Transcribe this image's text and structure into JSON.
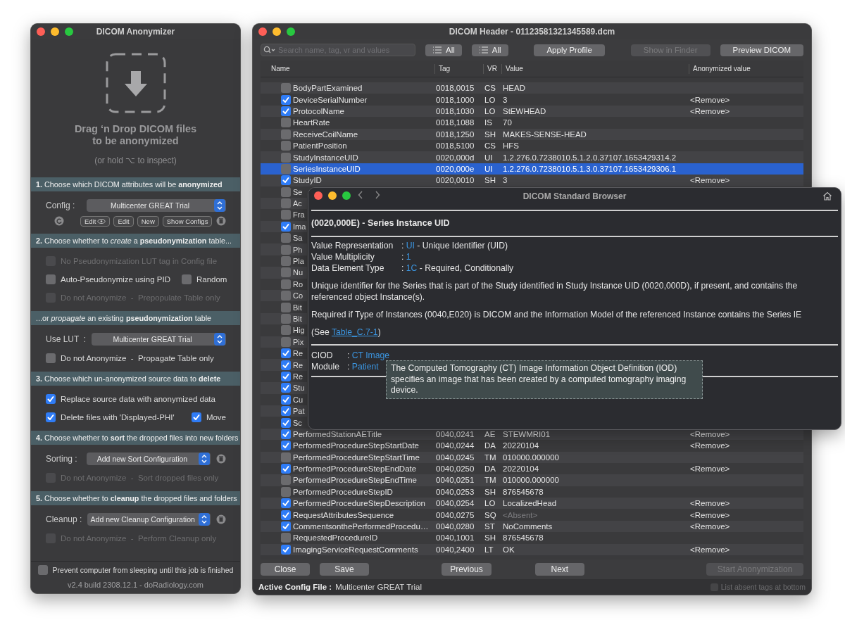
{
  "left_window": {
    "title": "DICOM Anonymizer",
    "drop_text": "Drag ‘n Drop DICOM files\nto be anonymized",
    "drop_hint": "(or hold ⌥ to inspect)",
    "sections": [
      {
        "header": "**1.** Choose which DICOM attributes will be **anonymized**",
        "items": [
          {
            "kind": "select",
            "label": "Config :",
            "value": "Multicenter GREAT Trial",
            "trash": false
          },
          {
            "kind": "buttons",
            "buttons": [
              {
                "label": "Edit",
                "eye": true
              },
              {
                "label": "Edit",
                "eye": false
              },
              {
                "label": "New",
                "eye": false
              },
              {
                "label": "Show Configs",
                "eye": false
              }
            ]
          }
        ]
      },
      {
        "header": "**2.** Choose whether to *create* a **pseudonymization** table...",
        "items": [
          {
            "kind": "checks",
            "checks": [
              {
                "label": "No Pseudonymization LUT tag in Config file",
                "checked": false,
                "disabled": true
              }
            ]
          },
          {
            "kind": "checks",
            "checks": [
              {
                "label": "Auto-Pseudonymize using PID",
                "checked": false,
                "disabled": false
              },
              {
                "label": "Random",
                "checked": false,
                "disabled": false
              }
            ]
          },
          {
            "kind": "checks",
            "checks": [
              {
                "label": "Do not Anonymize  -  Prepopulate Table only",
                "checked": false,
                "disabled": true
              }
            ]
          }
        ]
      },
      {
        "header": "...or *propagate* an existing **pseudonymization** table",
        "items": [
          {
            "kind": "select",
            "label": "Use LUT  :",
            "value": "Multicenter GREAT Trial",
            "trash": false
          },
          {
            "kind": "checks",
            "checks": [
              {
                "label": "Do not Anonymize  -  Propagate Table only",
                "checked": false,
                "disabled": false
              }
            ]
          }
        ]
      },
      {
        "header": "**3.** Choose which un-anonymized source data to **delete**",
        "items": [
          {
            "kind": "checks",
            "checks": [
              {
                "label": "Replace source data with anonymized data",
                "checked": true,
                "disabled": false
              }
            ]
          },
          {
            "kind": "checks",
            "checks": [
              {
                "label": "Delete files with 'Displayed-PHI'",
                "checked": true,
                "disabled": false
              },
              {
                "label": "Move",
                "checked": true,
                "disabled": false
              }
            ]
          }
        ]
      },
      {
        "header": "**4.** Choose whether to **sort** the dropped files into new folders",
        "items": [
          {
            "kind": "select",
            "label": "Sorting :",
            "value": "Add new Sort Configuration",
            "trash": true
          },
          {
            "kind": "checks",
            "checks": [
              {
                "label": "Do not Anonymize  -  Sort dropped files only",
                "checked": false,
                "disabled": true
              }
            ]
          }
        ]
      },
      {
        "header": "**5.** Choose whether to **cleanup** the dropped files and folders",
        "items": [
          {
            "kind": "select",
            "label": "Cleanup :",
            "value": "Add new Cleanup Configuration",
            "trash": true
          },
          {
            "kind": "checks",
            "checks": [
              {
                "label": "Do not Anonymize  -  Perform Cleanup only",
                "checked": false,
                "disabled": true
              }
            ]
          }
        ]
      }
    ],
    "sleep_option": {
      "label": "Prevent computer from sleeping until this job is finished",
      "checked": false
    },
    "version": "v2.4 build 2308.12.1 - doRadiology.com"
  },
  "header_window": {
    "title": "DICOM Header - 01123581321345589.dcm",
    "search": {
      "placeholder": "Search name, tag, vr and values"
    },
    "toolbar": [
      {
        "label": "All",
        "kind": "filter",
        "disabled": false
      },
      {
        "label": "All",
        "kind": "filter",
        "disabled": false
      },
      {
        "label": "Apply Profile",
        "kind": "plain",
        "disabled": false
      },
      {
        "label": "Show in Finder",
        "kind": "plain",
        "disabled": true
      },
      {
        "label": "Preview DICOM",
        "kind": "plain",
        "disabled": false
      }
    ],
    "columns": [
      "Name",
      "Tag",
      "VR",
      "Value",
      "Anonymized value"
    ],
    "rows": [
      {
        "name": "BodyPartExamined",
        "tag": "0018,0015",
        "vr": "CS",
        "value": "HEAD",
        "dimmed": false,
        "checked": false,
        "selected": false
      },
      {
        "name": "DeviceSerialNumber",
        "tag": "0018,1000",
        "vr": "LO",
        "value": "3",
        "dimmed": false,
        "anonymized": "<Remove>",
        "checked": true,
        "selected": false
      },
      {
        "name": "ProtocolName",
        "tag": "0018,1030",
        "vr": "LO",
        "value": "StEWHEAD",
        "dimmed": false,
        "anonymized": "<Remove>",
        "checked": true,
        "selected": false
      },
      {
        "name": "HeartRate",
        "tag": "0018,1088",
        "vr": "IS",
        "value": "70",
        "dimmed": false,
        "checked": false,
        "selected": false
      },
      {
        "name": "ReceiveCoilName",
        "tag": "0018,1250",
        "vr": "SH",
        "value": "MAKES-SENSE-HEAD",
        "dimmed": false,
        "checked": false,
        "selected": false
      },
      {
        "name": "PatientPosition",
        "tag": "0018,5100",
        "vr": "CS",
        "value": "HFS",
        "dimmed": false,
        "checked": false,
        "selected": false
      },
      {
        "name": "StudyInstanceUID",
        "tag": "0020,000d",
        "vr": "UI",
        "value": "1.2.276.0.7238010.5.1.2.0.37107.1653429314.2",
        "dimmed": false,
        "checked": false,
        "selected": false
      },
      {
        "name": "SeriesInstanceUID",
        "tag": "0020,000e",
        "vr": "UI",
        "value": "1.2.276.0.7238010.5.1.3.0.37107.1653429306.1",
        "dimmed": false,
        "checked": false,
        "selected": true
      },
      {
        "name": "StudyID",
        "tag": "0020,0010",
        "vr": "SH",
        "value": "3",
        "dimmed": false,
        "anonymized": "<Remove>",
        "checked": true,
        "selected": false
      },
      {
        "name": "Se",
        "checked": false,
        "selected": false
      },
      {
        "name": "Ac",
        "checked": false,
        "selected": false
      },
      {
        "name": "Fra",
        "checked": false,
        "selected": false
      },
      {
        "name": "Ima",
        "checked": true,
        "selected": false
      },
      {
        "name": "Sa",
        "checked": false,
        "selected": false
      },
      {
        "name": "Ph",
        "checked": false,
        "selected": false
      },
      {
        "name": "Pla",
        "checked": false,
        "selected": false
      },
      {
        "name": "Nu",
        "checked": false,
        "selected": false
      },
      {
        "name": "Ro",
        "checked": false,
        "selected": false
      },
      {
        "name": "Co",
        "checked": false,
        "selected": false
      },
      {
        "name": "Bit",
        "checked": false,
        "selected": false
      },
      {
        "name": "Bit",
        "checked": false,
        "selected": false
      },
      {
        "name": "Hig",
        "checked": false,
        "selected": false
      },
      {
        "name": "Pix",
        "checked": false,
        "selected": false
      },
      {
        "name": "Re",
        "checked": true,
        "selected": false
      },
      {
        "name": "Re",
        "checked": true,
        "selected": false
      },
      {
        "name": "Re",
        "checked": true,
        "selected": false
      },
      {
        "name": "Stu",
        "checked": true,
        "selected": false
      },
      {
        "name": "Cu",
        "checked": true,
        "selected": false
      },
      {
        "name": "Pat",
        "checked": true,
        "selected": false
      },
      {
        "name": "Sc",
        "checked": true,
        "selected": false
      },
      {
        "name": "PerformedStationAETitle",
        "tag": "0040,0241",
        "vr": "AE",
        "value": "STEWMRI01",
        "dimmed": false,
        "anonymized": "<Remove>",
        "checked": true,
        "selected": false
      },
      {
        "name": "PerformedProcedureStepStartDate",
        "tag": "0040,0244",
        "vr": "DA",
        "value": "20220104",
        "dimmed": false,
        "anonymized": "<Remove>",
        "checked": true,
        "selected": false
      },
      {
        "name": "PerformedProcedureStepStartTime",
        "tag": "0040,0245",
        "vr": "TM",
        "value": "010000.000000",
        "dimmed": false,
        "checked": false,
        "selected": false
      },
      {
        "name": "PerformedProcedureStepEndDate",
        "tag": "0040,0250",
        "vr": "DA",
        "value": "20220104",
        "dimmed": false,
        "anonymized": "<Remove>",
        "checked": true,
        "selected": false
      },
      {
        "name": "PerformedProcedureStepEndTime",
        "tag": "0040,0251",
        "vr": "TM",
        "value": "010000.000000",
        "dimmed": false,
        "checked": false,
        "selected": false
      },
      {
        "name": "PerformedProcedureStepID",
        "tag": "0040,0253",
        "vr": "SH",
        "value": "876545678",
        "dimmed": false,
        "checked": false,
        "selected": false
      },
      {
        "name": "PerformedProcedureStepDescription",
        "tag": "0040,0254",
        "vr": "LO",
        "value": "LocalizedHead",
        "dimmed": false,
        "anonymized": "<Remove>",
        "checked": true,
        "selected": false
      },
      {
        "name": "RequestAttributesSequence",
        "tag": "0040,0275",
        "vr": "SQ",
        "value": "<Absent>",
        "dimmed": true,
        "anonymized": "<Remove>",
        "checked": true,
        "selected": false
      },
      {
        "name": "CommentsonthePerformedProcedu…",
        "tag": "0040,0280",
        "vr": "ST",
        "value": "NoComments",
        "dimmed": false,
        "anonymized": "<Remove>",
        "checked": true,
        "selected": false
      },
      {
        "name": "RequestedProcedureID",
        "tag": "0040,1001",
        "vr": "SH",
        "value": "876545678",
        "dimmed": false,
        "checked": false,
        "selected": false
      },
      {
        "name": "ImagingServiceRequestComments",
        "tag": "0040,2400",
        "vr": "LT",
        "value": "OK",
        "dimmed": false,
        "anonymized": "<Remove>",
        "checked": true,
        "selected": false
      }
    ],
    "footer_left": [
      {
        "label": "Close",
        "disabled": false
      },
      {
        "label": "Save",
        "disabled": false
      }
    ],
    "footer_center": [
      {
        "label": "Previous",
        "disabled": false
      },
      {
        "label": "Next",
        "disabled": false
      }
    ],
    "footer_right": [
      {
        "label": "Start Anonymization",
        "disabled": true
      }
    ],
    "status": {
      "label": "Active Config File :",
      "value": "Multicenter GREAT Trial",
      "option": {
        "label": "List absent tags at bottom",
        "checked": false,
        "disabled": true
      }
    }
  },
  "browser_window": {
    "title": "DICOM Standard Browser",
    "heading": "(0020,000E) - Series Instance UID",
    "properties": [
      {
        "label": "Value Representation",
        "sep": ":",
        "code": "UI",
        "text": "- Unique Identifier (UID)"
      },
      {
        "label": "Value Multiplicity",
        "sep": ":",
        "code": "1"
      },
      {
        "label": "Data Element Type",
        "sep": ":",
        "code": "1C",
        "text": "- Required, Conditionally"
      }
    ],
    "paragraphs": [
      "Unique identifier for the Series that is part of the Study identified in Study Instance UID (0020,000D), if present, and contains the referenced object Instance(s).",
      "Required if Type of Instances (0040,E020) is DICOM and the Information Model of the referenced Instance contains the Series IE"
    ],
    "see": {
      "before": "(See ",
      "link": "Table_C.7-1",
      "after": ")"
    },
    "refs": [
      {
        "label": "CIOD",
        "sep": ":",
        "code": "CT Image"
      },
      {
        "label": "Module",
        "sep": ":",
        "code": "Patient"
      }
    ],
    "tooltip": "The Computed Tomography (CT) Image Information Object Definition (IOD) specifies an image that has been created by a computed tomography imaging device."
  }
}
